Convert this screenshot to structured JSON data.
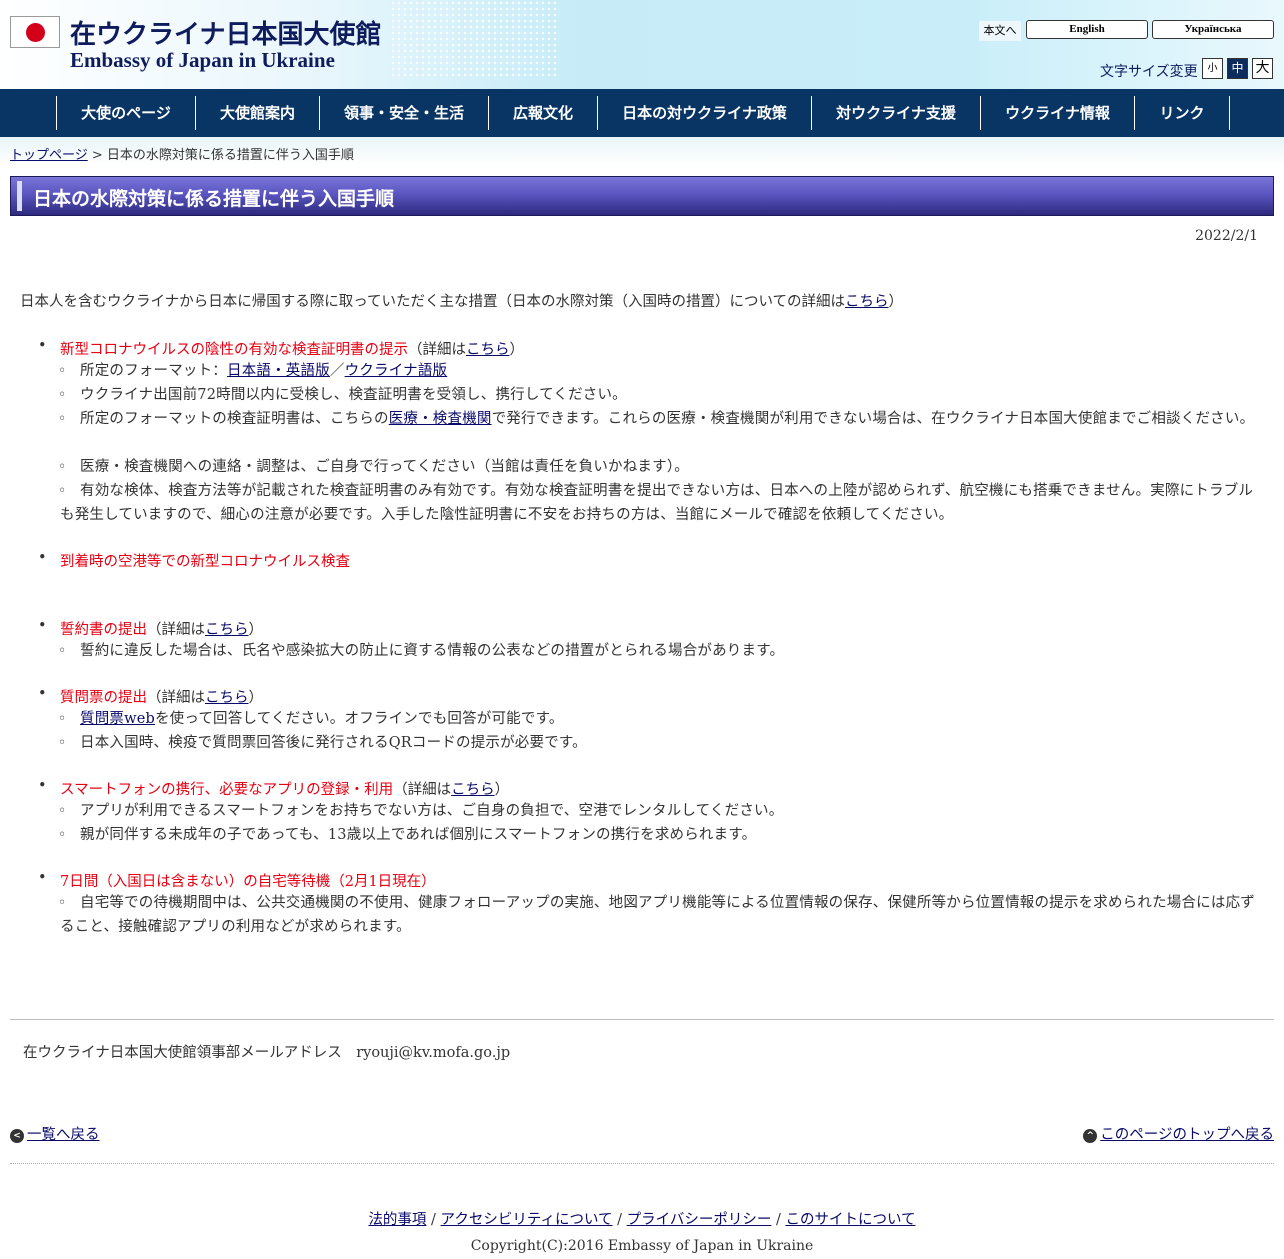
{
  "header": {
    "title_ja": "在ウクライナ日本国大使館",
    "title_en": "Embassy of Japan in Ukraine",
    "skip_to_content": "本文へ",
    "lang_english": "English",
    "lang_ukrainian": "Українська",
    "font_size_label": "文字サイズ変更",
    "font_small": "小",
    "font_medium": "中",
    "font_large": "大"
  },
  "nav": {
    "items": [
      "大使のページ",
      "大使館案内",
      "領事・安全・生活",
      "広報文化",
      "日本の対ウクライナ政策",
      "対ウクライナ支援",
      "ウクライナ情報",
      "リンク"
    ]
  },
  "breadcrumb": {
    "home": "トップページ",
    "separator": " > ",
    "current": "日本の水際対策に係る措置に伴う入国手順"
  },
  "page": {
    "title": "日本の水際対策に係る措置に伴う入国手順",
    "date": "2022/2/1",
    "intro_text": "日本人を含むウクライナから日本に帰国する際に取っていただく主な措置（日本の水際対策（入国時の措置）についての詳細は",
    "intro_link": "こちら",
    "intro_end": "）"
  },
  "sections": {
    "s1": {
      "title": "新型コロナウイルスの陰性の有効な検査証明書の提示",
      "detail_prefix": "（詳細は",
      "detail_link": "こちら",
      "detail_suffix": "）",
      "sub1_prefix": "所定のフォーマット：",
      "sub1_link1": "日本語・英語版",
      "sub1_sep": "／",
      "sub1_link2": "ウクライナ語版",
      "sub2": "ウクライナ出国前72時間以内に受検し、検査証明書を受領し、携行してください。",
      "sub3_prefix": "所定のフォーマットの検査証明書は、こちらの",
      "sub3_link": "医療・検査機関",
      "sub3_suffix": "で発行できます。これらの医療・検査機関が利用できない場合は、在ウクライナ日本国大使館までご相談ください。",
      "sub4": "医療・検査機関への連絡・調整は、ご自身で行ってください（当館は責任を負いかねます）。",
      "sub5": "有効な検体、検査方法等が記載された検査証明書のみ有効です。有効な検査証明書を提出できない方は、日本への上陸が認められず、航空機にも搭乗できません。実際にトラブルも発生していますので、細心の注意が必要です。入手した陰性証明書に不安をお持ちの方は、当館にメールで確認を依頼してください。"
    },
    "s2": {
      "title": "到着時の空港等での新型コロナウイルス検査"
    },
    "s3": {
      "title": "誓約書の提出",
      "detail_prefix": "（詳細は",
      "detail_link": "こちら",
      "detail_suffix": "）",
      "sub1": "誓約に違反した場合は、氏名や感染拡大の防止に資する情報の公表などの措置がとられる場合があります。"
    },
    "s4": {
      "title": "質問票の提出",
      "detail_prefix": "（詳細は",
      "detail_link": "こちら",
      "detail_suffix": "）",
      "sub1_link": "質問票web",
      "sub1_suffix": "を使って回答してください。オフラインでも回答が可能です。",
      "sub2": "日本入国時、検疫で質問票回答後に発行されるQRコードの提示が必要です。"
    },
    "s5": {
      "title": "スマートフォンの携行、必要なアプリの登録・利用",
      "detail_prefix": "（詳細は",
      "detail_link": "こちら",
      "detail_suffix": "）",
      "sub1": "アプリが利用できるスマートフォンをお持ちでない方は、ご自身の負担で、空港でレンタルしてください。",
      "sub2": "親が同伴する未成年の子であっても、13歳以上であれば個別にスマートフォンの携行を求められます。"
    },
    "s6": {
      "title": "7日間（入国日は含まない）の自宅等待機（2月1日現在）",
      "sub1": "自宅等での待機期間中は、公共交通機関の不使用、健康フォローアップの実施、地図アプリ機能等による位置情報の保存、保健所等から位置情報の提示を求められた場合には応ずること、接触確認アプリの利用などが求められます。"
    }
  },
  "contact": {
    "text": "在ウクライナ日本国大使館領事部メールアドレス　ryouji@kv.mofa.go.jp"
  },
  "pager": {
    "back_to_list": "一覧へ戻る",
    "back_to_top": "このページのトップへ戻る"
  },
  "footer": {
    "links": [
      "法的事項",
      "アクセシビリティについて",
      "プライバシーポリシー",
      "このサイトについて"
    ],
    "separator": " / ",
    "copyright": "Copyright(C):2016 Embassy of Japan in Ukraine"
  },
  "colors": {
    "nav_bg": "#093565",
    "title_ja": "#0e1c5e",
    "emphasis_red": "#e60012",
    "title_bar": "#5a55c0"
  }
}
